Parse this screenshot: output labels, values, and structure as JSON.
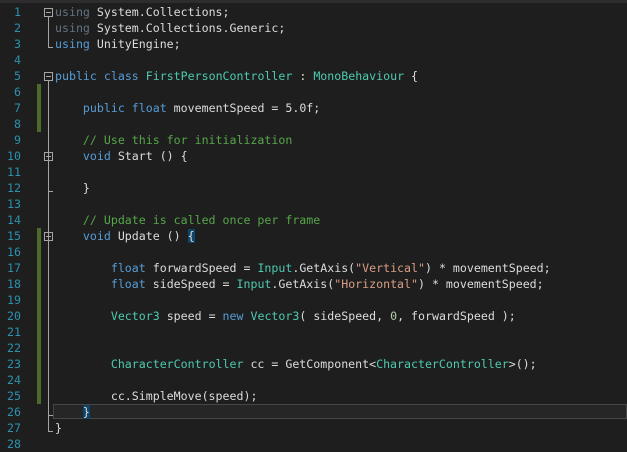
{
  "editor": {
    "current_line": 26,
    "changed_lines": [
      6,
      7,
      8,
      15,
      16,
      17,
      18,
      19,
      20,
      21,
      22,
      23,
      24,
      25
    ],
    "fold_markers": [
      1,
      5,
      10,
      15
    ],
    "lines": [
      [
        [
          "dim",
          "using"
        ],
        [
          "tx",
          " System.Collections;"
        ]
      ],
      [
        [
          "dim",
          "using"
        ],
        [
          "tx",
          " System.Collections.Generic;"
        ]
      ],
      [
        [
          "kw",
          "using"
        ],
        [
          "tx",
          " UnityEngine;"
        ]
      ],
      [],
      [
        [
          "kw",
          "public"
        ],
        [
          "tx",
          " "
        ],
        [
          "kw",
          "class"
        ],
        [
          "tx",
          " "
        ],
        [
          "ty",
          "FirstPersonController"
        ],
        [
          "tx",
          " : "
        ],
        [
          "ty",
          "MonoBehaviour"
        ],
        [
          "tx",
          " {"
        ]
      ],
      [],
      [
        [
          "tx",
          "    "
        ],
        [
          "kw",
          "public"
        ],
        [
          "tx",
          " "
        ],
        [
          "kw",
          "float"
        ],
        [
          "tx",
          " movementSpeed = 5.0f;"
        ]
      ],
      [],
      [
        [
          "tx",
          "    "
        ],
        [
          "cm",
          "// Use this for initialization"
        ]
      ],
      [
        [
          "tx",
          "    "
        ],
        [
          "kw",
          "void"
        ],
        [
          "tx",
          " Start () {"
        ]
      ],
      [],
      [
        [
          "tx",
          "    }"
        ]
      ],
      [],
      [
        [
          "tx",
          "    "
        ],
        [
          "cm",
          "// Update is called once per frame"
        ]
      ],
      [
        [
          "tx",
          "    "
        ],
        [
          "kw",
          "void"
        ],
        [
          "tx",
          " Update () "
        ],
        [
          "br",
          "{"
        ]
      ],
      [],
      [
        [
          "tx",
          "        "
        ],
        [
          "kw",
          "float"
        ],
        [
          "tx",
          " forwardSpeed = "
        ],
        [
          "ty",
          "Input"
        ],
        [
          "tx",
          ".GetAxis("
        ],
        [
          "st",
          "\"Vertical\""
        ],
        [
          "tx",
          ") * movementSpeed;"
        ]
      ],
      [
        [
          "tx",
          "        "
        ],
        [
          "kw",
          "float"
        ],
        [
          "tx",
          " sideSpeed = "
        ],
        [
          "ty",
          "Input"
        ],
        [
          "tx",
          ".GetAxis("
        ],
        [
          "st",
          "\"Horizontal\""
        ],
        [
          "tx",
          ") * movementSpeed;"
        ]
      ],
      [],
      [
        [
          "tx",
          "        "
        ],
        [
          "ty",
          "Vector3"
        ],
        [
          "tx",
          " speed = "
        ],
        [
          "kw",
          "new"
        ],
        [
          "tx",
          " "
        ],
        [
          "ty",
          "Vector3"
        ],
        [
          "tx",
          "( sideSpeed, "
        ],
        [
          "nu",
          "0"
        ],
        [
          "tx",
          ", forwardSpeed );"
        ]
      ],
      [],
      [],
      [
        [
          "tx",
          "        "
        ],
        [
          "ty",
          "CharacterController"
        ],
        [
          "tx",
          " cc = GetComponent<"
        ],
        [
          "ty",
          "CharacterController"
        ],
        [
          "tx",
          ">();"
        ]
      ],
      [],
      [
        [
          "tx",
          "        cc.SimpleMove(speed);"
        ]
      ],
      [
        [
          "tx",
          "    "
        ],
        [
          "br",
          "}"
        ]
      ],
      [
        [
          "tx",
          "}"
        ]
      ],
      []
    ]
  }
}
